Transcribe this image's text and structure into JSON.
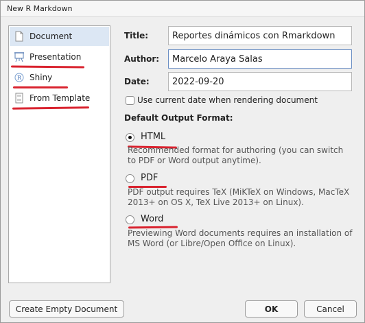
{
  "window": {
    "title": "New R Markdown"
  },
  "sidebar": {
    "items": [
      {
        "label": "Document",
        "selected": true,
        "icon": "document-icon"
      },
      {
        "label": "Presentation",
        "selected": false,
        "icon": "presentation-icon"
      },
      {
        "label": "Shiny",
        "selected": false,
        "icon": "shiny-r-icon"
      },
      {
        "label": "From Template",
        "selected": false,
        "icon": "template-icon"
      }
    ]
  },
  "form": {
    "title_label": "Title:",
    "title_value": "Reportes dinámicos con Rmarkdown",
    "author_label": "Author:",
    "author_value": "Marcelo Araya Salas",
    "date_label": "Date:",
    "date_value": "2022-09-20",
    "use_current_date_label": "Use current date when rendering document",
    "use_current_date_checked": false
  },
  "output": {
    "heading": "Default Output Format:",
    "options": [
      {
        "label": "HTML",
        "checked": true,
        "description": "Recommended format for authoring (you can switch to PDF or Word output anytime)."
      },
      {
        "label": "PDF",
        "checked": false,
        "description": "PDF output requires TeX (MiKTeX on Windows, MacTeX 2013+ on OS X, TeX Live 2013+ on Linux)."
      },
      {
        "label": "Word",
        "checked": false,
        "description": "Previewing Word documents requires an installation of MS Word (or Libre/Open Office on Linux)."
      }
    ]
  },
  "buttons": {
    "create_empty": "Create Empty Document",
    "ok": "OK",
    "cancel": "Cancel"
  },
  "colors": {
    "annotation_underline": "#d9232f",
    "selection": "#dce7f4"
  }
}
